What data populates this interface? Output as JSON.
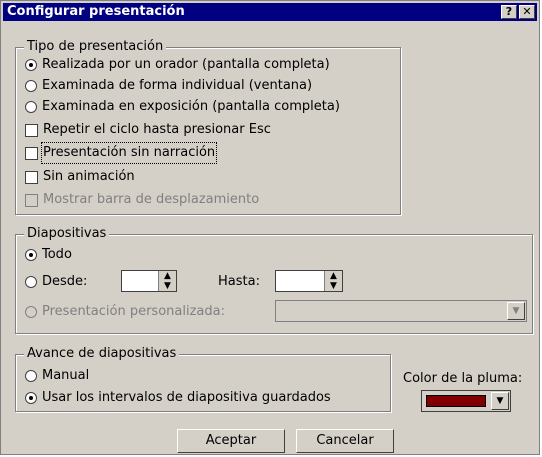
{
  "window": {
    "title": "Configurar presentación",
    "help_label": "?",
    "close_label": "✕"
  },
  "tipo": {
    "legend": "Tipo de presentación",
    "radios": [
      {
        "label": "Realizada por un orador (pantalla completa)",
        "checked": true
      },
      {
        "label": "Examinada de forma individual (ventana)",
        "checked": false
      },
      {
        "label": "Examinada en exposición (pantalla completa)",
        "checked": false
      }
    ],
    "checks": [
      {
        "label": "Repetir el ciclo hasta presionar Esc",
        "checked": false,
        "enabled": true
      },
      {
        "label": "Presentación sin narración",
        "checked": false,
        "enabled": true
      },
      {
        "label": "Sin animación",
        "checked": false,
        "enabled": true
      },
      {
        "label": "Mostrar barra de desplazamiento",
        "checked": false,
        "enabled": false
      }
    ]
  },
  "diapositivas": {
    "legend": "Diapositivas",
    "todo_label": "Todo",
    "desde_label": "Desde:",
    "hasta_label": "Hasta:",
    "personalizada_label": "Presentación personalizada:"
  },
  "avance": {
    "legend": "Avance de diapositivas",
    "manual_label": "Manual",
    "intervalos_label": "Usar los intervalos de diapositiva guardados"
  },
  "pluma": {
    "label": "Color de la pluma:",
    "color": "#800000"
  },
  "buttons": {
    "ok": "Aceptar",
    "cancel": "Cancelar"
  }
}
